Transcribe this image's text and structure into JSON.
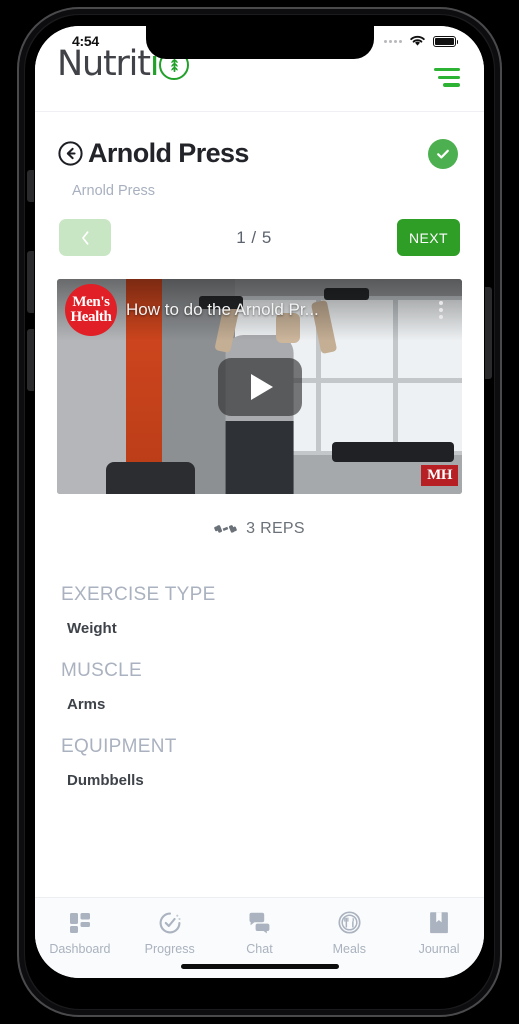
{
  "status_bar": {
    "time": "4:54",
    "signal_icon": "signal-dots-icon",
    "wifi_icon": "wifi-icon",
    "battery_icon": "battery-full-icon"
  },
  "header": {
    "brand_main": "Nutrit",
    "brand_accent": "i",
    "brand_mark_icon": "wheat-circle-icon",
    "menu_icon": "hamburger-menu-icon",
    "accent_color": "#2db334"
  },
  "page": {
    "title": "Arnold Press",
    "subtitle": "Arnold Press",
    "back_icon": "back-arrow-circle-icon",
    "complete_icon": "check-circle-icon",
    "complete_color": "#4caf50"
  },
  "pager": {
    "prev_icon": "chevron-left-icon",
    "prev_disabled_color": "#c9e6c4",
    "count": "1 / 5",
    "next_label": "NEXT",
    "next_color": "#2e9e27"
  },
  "video": {
    "channel_logo_line1": "Men's",
    "channel_logo_line2": "Health",
    "title": "How to do the Arnold Pr...",
    "more_icon": "kebab-menu-icon",
    "play_icon": "play-button-icon",
    "watermark": "MH"
  },
  "reps": {
    "icon": "dumbbell-icon",
    "text": "3 REPS"
  },
  "details": [
    {
      "label": "EXERCISE TYPE",
      "value": "Weight"
    },
    {
      "label": "MUSCLE",
      "value": "Arms"
    },
    {
      "label": "EQUIPMENT",
      "value": "Dumbbells"
    }
  ],
  "bottom_nav": [
    {
      "label": "Dashboard",
      "icon": "dashboard-grid-icon"
    },
    {
      "label": "Progress",
      "icon": "progress-circle-icon"
    },
    {
      "label": "Chat",
      "icon": "chat-bubbles-icon"
    },
    {
      "label": "Meals",
      "icon": "utensils-circle-icon"
    },
    {
      "label": "Journal",
      "icon": "book-icon"
    }
  ]
}
